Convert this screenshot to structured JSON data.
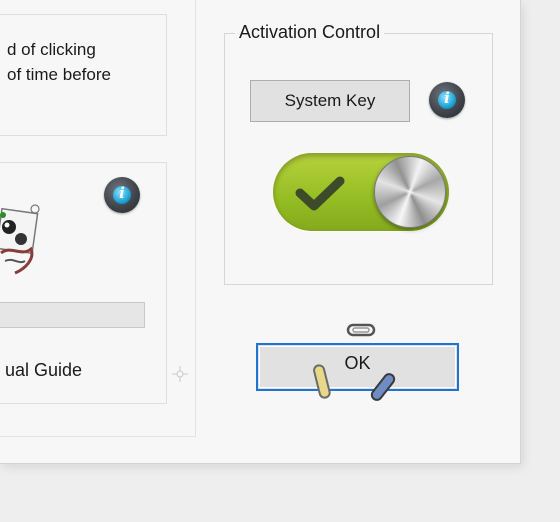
{
  "dialog": {
    "top_panel": {
      "text": "d of clicking\nof time before"
    },
    "visual_guide": {
      "label": "ual Guide",
      "info_glyph": "i",
      "progress_fraction": 0
    },
    "activation_control": {
      "title": "Activation Control",
      "system_key_label": "System Key",
      "info_glyph": "i",
      "toggle": {
        "state": "on",
        "icon": "checkmark-icon"
      }
    },
    "ok_label": "OK"
  },
  "colors": {
    "toggle_on": "#9bc22b",
    "focus_border": "#1f73d2",
    "info_blue": "#1fa3d6"
  }
}
